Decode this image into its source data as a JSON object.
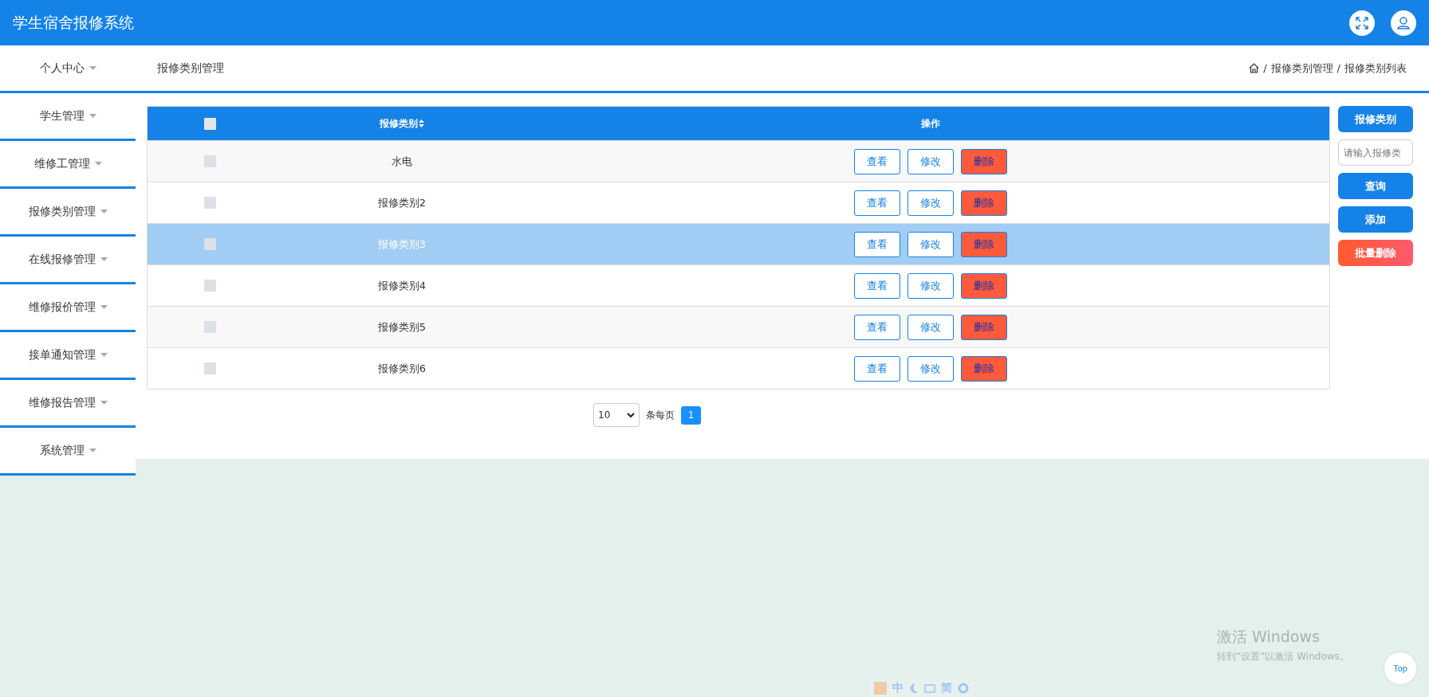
{
  "app_title": "学生宿舍报修系统",
  "sidebar": {
    "items": [
      {
        "label": "个人中心",
        "selected": false
      },
      {
        "label": "学生管理",
        "selected": false
      },
      {
        "label": "维修工管理",
        "selected": false
      },
      {
        "label": "报修类别管理",
        "selected": false
      },
      {
        "label": "在线报修管理",
        "selected": false
      },
      {
        "label": "维修报价管理",
        "selected": false
      },
      {
        "label": "接单通知管理",
        "selected": false
      },
      {
        "label": "维修报告管理",
        "selected": false
      },
      {
        "label": "系统管理",
        "selected": false
      }
    ]
  },
  "page_title": "报修类别管理",
  "breadcrumb": [
    "报修类别管理",
    "报修类别列表"
  ],
  "breadcrumb_separator": "/",
  "table": {
    "header_checked": false,
    "columns": [
      "报修类别",
      "操作"
    ],
    "rows": [
      {
        "checked": false,
        "selected": false,
        "category": "水电",
        "actions": [
          "查看",
          "修改",
          "删除"
        ]
      },
      {
        "checked": false,
        "selected": false,
        "category": "报修类别2",
        "actions": [
          "查看",
          "修改",
          "删除"
        ]
      },
      {
        "checked": false,
        "selected": true,
        "category": "报修类别3",
        "actions": [
          "查看",
          "修改",
          "删除"
        ]
      },
      {
        "checked": false,
        "selected": false,
        "category": "报修类别4",
        "actions": [
          "查看",
          "修改",
          "删除"
        ]
      },
      {
        "checked": false,
        "selected": false,
        "category": "报修类别5",
        "actions": [
          "查看",
          "修改",
          "删除"
        ]
      },
      {
        "checked": false,
        "selected": false,
        "category": "报修类别6",
        "actions": [
          "查看",
          "修改",
          "删除"
        ]
      }
    ]
  },
  "pagination": {
    "page_size": "10",
    "per_page_label": "条每页",
    "pages": [
      {
        "label": "1",
        "selected": true
      }
    ]
  },
  "side_panel": {
    "field_label": "报修类别",
    "search": {
      "placeholder": "请输入报修类"
    },
    "buttons": [
      {
        "kind": "primary",
        "label": "查询"
      },
      {
        "kind": "primary",
        "label": "添加"
      },
      {
        "kind": "danger",
        "label": "批量删除"
      }
    ]
  },
  "windows_notice": {
    "title": "激活 Windows",
    "text": "转到“设置”以激活 Windows。"
  },
  "ime_toolbar": {
    "labels": [
      "中",
      "简"
    ]
  },
  "back_to_top": "Top"
}
